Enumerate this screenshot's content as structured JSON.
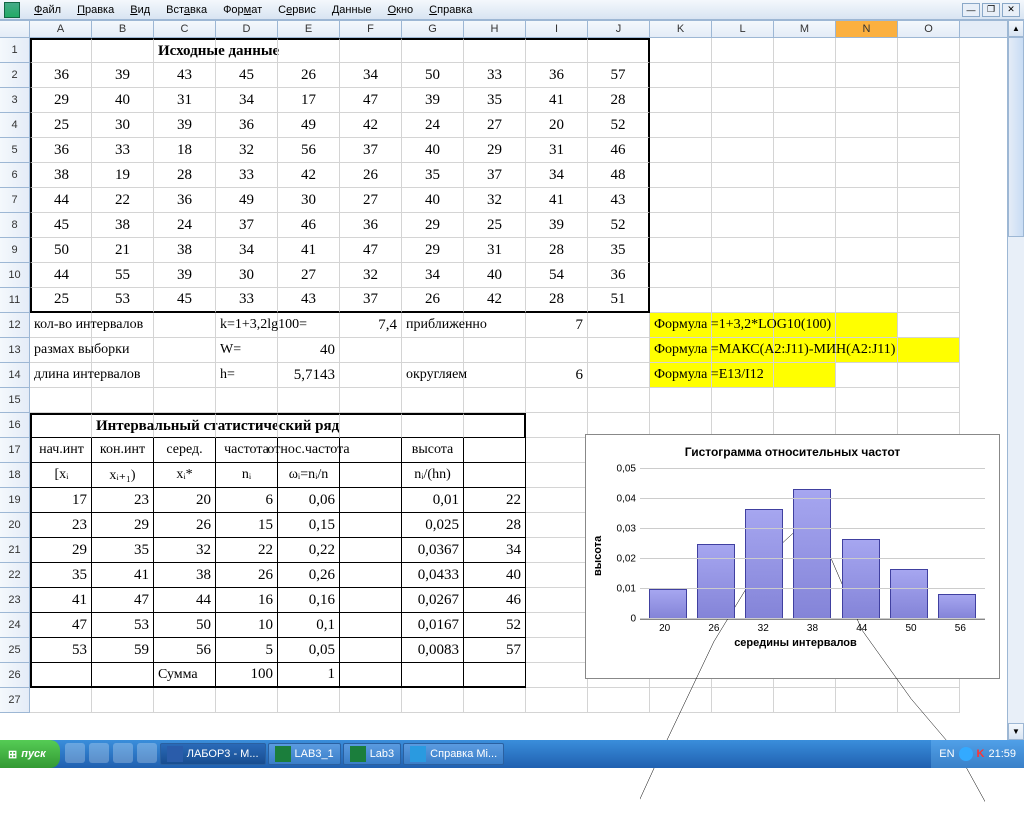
{
  "menu": {
    "file": "Файл",
    "edit": "Правка",
    "view": "Вид",
    "insert": "Вставка",
    "format": "Формат",
    "tools": "Сервис",
    "data": "Данные",
    "window": "Окно",
    "help": "Справка"
  },
  "columns": [
    "A",
    "B",
    "C",
    "D",
    "E",
    "F",
    "G",
    "H",
    "I",
    "J",
    "K",
    "L",
    "M",
    "N",
    "O"
  ],
  "header_title": "Исходные данные",
  "data_rows": [
    [
      36,
      39,
      43,
      45,
      26,
      34,
      50,
      33,
      36,
      57
    ],
    [
      29,
      40,
      31,
      34,
      17,
      47,
      39,
      35,
      41,
      28
    ],
    [
      25,
      30,
      39,
      36,
      49,
      42,
      24,
      27,
      20,
      52
    ],
    [
      36,
      33,
      18,
      32,
      56,
      37,
      40,
      29,
      31,
      46
    ],
    [
      38,
      19,
      28,
      33,
      42,
      26,
      35,
      37,
      34,
      48
    ],
    [
      44,
      22,
      36,
      49,
      30,
      27,
      40,
      32,
      41,
      43
    ],
    [
      45,
      38,
      24,
      37,
      46,
      36,
      29,
      25,
      39,
      52
    ],
    [
      50,
      21,
      38,
      34,
      41,
      47,
      29,
      31,
      28,
      35
    ],
    [
      44,
      55,
      39,
      30,
      27,
      32,
      34,
      40,
      54,
      36
    ],
    [
      25,
      53,
      45,
      33,
      43,
      37,
      26,
      42,
      28,
      51
    ]
  ],
  "labels": {
    "intervals": "кол-во интервалов",
    "k_eq": "k=1+3,2lg100=",
    "k_val": "7,4",
    "approx": "приближенно",
    "k_round": "7",
    "range": "размах выборки",
    "W_eq": "W=",
    "W_val": "40",
    "ilen": "длина интервалов",
    "h_eq": "h=",
    "h_val": "5,7143",
    "round": "округляем",
    "h_round": "6",
    "formulas": [
      "Формула =1+3,2*LOG10(100)",
      "Формула =МАКС(A2:J11)-МИН(A2:J11)",
      "Формула =E13/I12"
    ],
    "series_title": "Интервальный статистический ряд",
    "th1": [
      "нач.инт",
      "кон.инт",
      "серед.",
      "частота",
      "относ.частота",
      "",
      "высота",
      ""
    ],
    "th2": [
      "[xᵢ",
      "xᵢ₊₁)",
      "xᵢ*",
      "nᵢ",
      "ωᵢ=nᵢ/n",
      "",
      "nᵢ/(hn)",
      ""
    ],
    "sum": "Сумма",
    "sum_n": "100",
    "sum_w": "1"
  },
  "intervals": [
    [
      17,
      23,
      20,
      6,
      "0,06",
      "",
      "0,01",
      22
    ],
    [
      23,
      29,
      26,
      15,
      "0,15",
      "",
      "0,025",
      28
    ],
    [
      29,
      35,
      32,
      22,
      "0,22",
      "",
      "0,0367",
      34
    ],
    [
      35,
      41,
      38,
      26,
      "0,26",
      "",
      "0,0433",
      40
    ],
    [
      41,
      47,
      44,
      16,
      "0,16",
      "",
      "0,0267",
      46
    ],
    [
      47,
      53,
      50,
      10,
      "0,1",
      "",
      "0,0167",
      52
    ],
    [
      53,
      59,
      56,
      5,
      "0,05",
      "",
      "0,0083",
      57
    ]
  ],
  "chart_data": {
    "type": "bar",
    "title": "Гистограмма относительных частот",
    "xlabel": "середины интервалов",
    "ylabel": "высота",
    "categories": [
      20,
      26,
      32,
      38,
      44,
      50,
      56
    ],
    "values": [
      0.01,
      0.025,
      0.0367,
      0.0433,
      0.0267,
      0.0167,
      0.0083
    ],
    "ylim": [
      0,
      0.05
    ],
    "yticks": [
      "0",
      "0,01",
      "0,02",
      "0,03",
      "0,04",
      "0,05"
    ]
  },
  "taskbar": {
    "start": "пуск",
    "items": [
      "ЛАБОР3 - М...",
      "LAB3_1",
      "Lab3",
      "Справка Mi..."
    ],
    "lang": "EN",
    "time": "21:59"
  }
}
